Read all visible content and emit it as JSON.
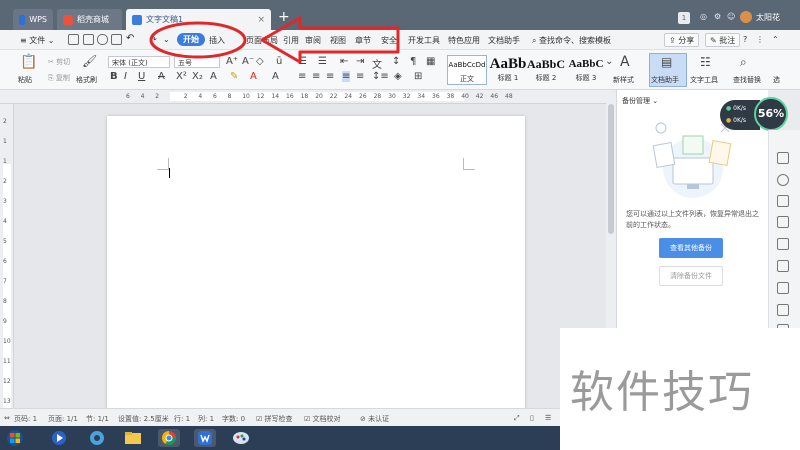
{
  "tabbar": {
    "tabs": [
      {
        "label": "WPS"
      },
      {
        "label": "稻壳商城"
      },
      {
        "label": "文字文稿1"
      }
    ],
    "badge_count": "1",
    "user_name": "太阳花"
  },
  "menubar": {
    "file_label": "文件",
    "tabs": [
      {
        "label": "开始"
      },
      {
        "label": "插入"
      },
      {
        "label": "页面布局"
      },
      {
        "label": "引用"
      },
      {
        "label": "审阅"
      },
      {
        "label": "视图"
      },
      {
        "label": "章节"
      },
      {
        "label": "安全"
      },
      {
        "label": "开发工具"
      },
      {
        "label": "特色应用"
      },
      {
        "label": "文档助手"
      }
    ],
    "search_label": "查找命令、搜索模板",
    "share_label": "分享",
    "comment_label": "批注"
  },
  "ribbon": {
    "paste_label": "粘贴",
    "cut_label": "剪切",
    "copy_label": "复制",
    "format_painter_label": "格式刷",
    "font_name": "宋体 (正文)",
    "font_size": "五号",
    "styles": [
      {
        "sample": "AaBbCcDd",
        "name": "正文"
      },
      {
        "sample": "AaBb",
        "name": "标题 1"
      },
      {
        "sample": "AaBbC",
        "name": "标题 2"
      },
      {
        "sample": "AaBbC",
        "name": "标题 3"
      }
    ],
    "new_style_label": "新样式",
    "doc_assistant_label": "文档助手",
    "text_tools_label": "文字工具",
    "find_replace_label": "查找替换",
    "select_label": "选"
  },
  "ruler": {
    "numbers": [
      "6",
      "4",
      "2",
      "2",
      "4",
      "6",
      "8",
      "10",
      "12",
      "14",
      "16",
      "18",
      "20",
      "22",
      "24",
      "26",
      "28",
      "30",
      "32",
      "34",
      "36",
      "38",
      "40",
      "42",
      "46",
      "48"
    ],
    "vnumbers": [
      "2",
      "1",
      "1",
      "2",
      "3",
      "4",
      "5",
      "6",
      "7",
      "8",
      "9",
      "10",
      "11",
      "12",
      "13"
    ]
  },
  "panel": {
    "title": "备份管理",
    "description": "您可以通过以上文件列表，恢复异常退出之前的工作状态。",
    "view_backup_label": "查看其他备份",
    "clear_backup_label": "清除备份文件"
  },
  "speed": {
    "up": "0K/s",
    "down": "0K/s",
    "percent": "56%"
  },
  "statusbar": {
    "page_num": "页码: 1",
    "pages": "页面: 1/1",
    "section": "节: 1/1",
    "setting": "设置值: 2.5厘米",
    "row": "行: 1",
    "col": "列: 1",
    "words": "字数: 0",
    "spell_check": "拼写检查",
    "doc_proof": "文档校对",
    "unverified": "未认证"
  },
  "watermark": {
    "text": "软件技巧"
  },
  "colors": {
    "accent": "#3b7ddd",
    "tabbar": "#5a6775",
    "annotation": "#e0282a"
  }
}
